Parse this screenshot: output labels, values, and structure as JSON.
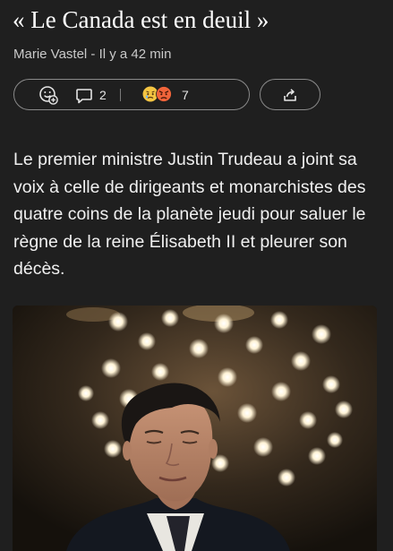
{
  "article": {
    "title": "« Le Canada est en deuil »",
    "byline": "Marie Vastel - Il y a 42 min",
    "body": "Le premier ministre Justin Trudeau a joint sa voix à celle de dirigeants et monarchistes des quatre coins de la planète jeudi pour saluer le règne de la reine Élisabeth II et pleurer son décès."
  },
  "actions": {
    "add_reaction_icon": "smiley-plus-icon",
    "comment_icon": "speech-bubble-icon",
    "comment_count": "2",
    "reaction_icons": [
      "sad-face-emoji",
      "angry-face-emoji"
    ],
    "reaction_count": "7",
    "share_icon": "share-arrow-icon"
  },
  "image": {
    "subject": "photo-man-chandelier"
  },
  "colors": {
    "background": "#1f1f1f",
    "text": "#f2f2f2",
    "muted": "#c9c9c9",
    "border": "#8a8a8a"
  }
}
